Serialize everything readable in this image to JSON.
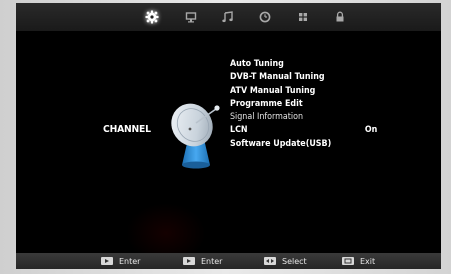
{
  "tabs": [
    {
      "name": "channel",
      "icon": "satellite-gear-icon",
      "active": true
    },
    {
      "name": "picture",
      "icon": "monitor-icon",
      "active": false
    },
    {
      "name": "sound",
      "icon": "music-note-icon",
      "active": false
    },
    {
      "name": "time",
      "icon": "clock-icon",
      "active": false
    },
    {
      "name": "setup",
      "icon": "grid-icon",
      "active": false
    },
    {
      "name": "lock",
      "icon": "lock-icon",
      "active": false
    }
  ],
  "section": {
    "title": "CHANNEL",
    "icon": "satellite-dish-icon"
  },
  "menu": {
    "items": [
      {
        "label": "Auto Tuning",
        "value": ""
      },
      {
        "label": "DVB-T Manual Tuning",
        "value": ""
      },
      {
        "label": "ATV Manual Tuning",
        "value": ""
      },
      {
        "label": "Programme Edit",
        "value": ""
      },
      {
        "label": "Signal Information",
        "value": ""
      },
      {
        "label": "LCN",
        "value": "On"
      },
      {
        "label": "Software Update(USB)",
        "value": ""
      }
    ]
  },
  "footer": {
    "hints": [
      {
        "key": "enter-key-icon",
        "label": "Enter"
      },
      {
        "key": "enter-key-icon",
        "label": "Enter"
      },
      {
        "key": "select-key-icon",
        "label": "Select"
      },
      {
        "key": "exit-key-icon",
        "label": "Exit"
      }
    ]
  },
  "colors": {
    "background": "#000000",
    "text": "#ffffff",
    "bar": "#2a2a2a",
    "dish_body": "#cfd8e0",
    "dish_stand": "#2f8fd8"
  }
}
